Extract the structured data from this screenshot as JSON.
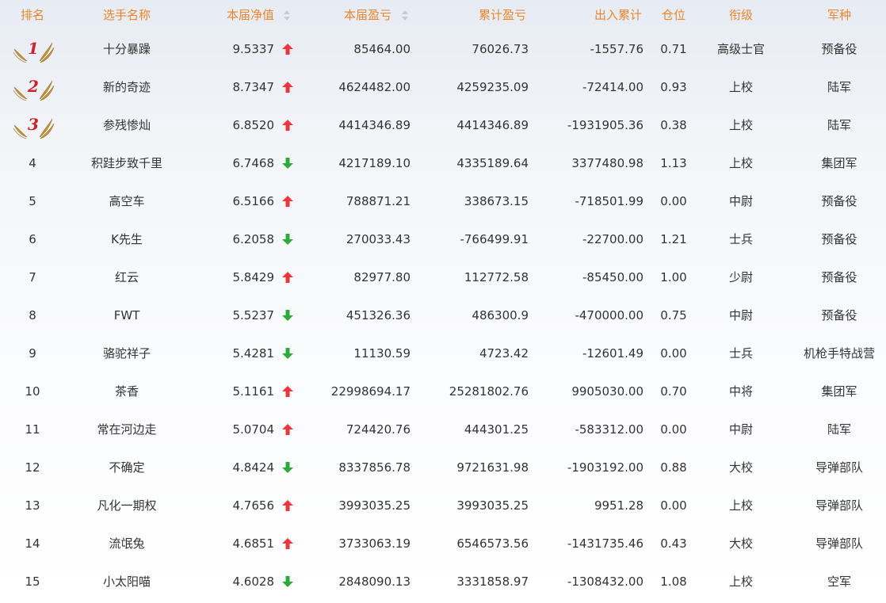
{
  "header": {
    "rank": "排名",
    "player": "选手名称",
    "nav": "本届净值",
    "profit": "本届盈亏",
    "total_profit": "累计盈亏",
    "flow": "出入累计",
    "position": "仓位",
    "title": "衔级",
    "branch": "军种"
  },
  "colors": {
    "header_text": "#e8872f",
    "up_arrow": "#e8383d",
    "down_arrow": "#2eaa3a",
    "medal_number": "#d0202a",
    "medal_wing": "#c9963a"
  },
  "rows": [
    {
      "rank": "1",
      "player": "十分暴躁",
      "nav": "9.5337",
      "trend": "up",
      "profit": "85464.00",
      "total_profit": "76026.73",
      "flow": "-1557.76",
      "position": "0.71",
      "title": "高级士官",
      "branch": "预备役"
    },
    {
      "rank": "2",
      "player": "新的奇迹",
      "nav": "8.7347",
      "trend": "up",
      "profit": "4624482.00",
      "total_profit": "4259235.09",
      "flow": "-72414.00",
      "position": "0.93",
      "title": "上校",
      "branch": "陆军"
    },
    {
      "rank": "3",
      "player": "参残惨灿",
      "nav": "6.8520",
      "trend": "up",
      "profit": "4414346.89",
      "total_profit": "4414346.89",
      "flow": "-1931905.36",
      "position": "0.38",
      "title": "上校",
      "branch": "陆军"
    },
    {
      "rank": "4",
      "player": "积跬步致千里",
      "nav": "6.7468",
      "trend": "down",
      "profit": "4217189.10",
      "total_profit": "4335189.64",
      "flow": "3377480.98",
      "position": "1.13",
      "title": "上校",
      "branch": "集团军"
    },
    {
      "rank": "5",
      "player": "高空车",
      "nav": "6.5166",
      "trend": "up",
      "profit": "788871.21",
      "total_profit": "338673.15",
      "flow": "-718501.99",
      "position": "0.00",
      "title": "中尉",
      "branch": "预备役"
    },
    {
      "rank": "6",
      "player": "K先生",
      "nav": "6.2058",
      "trend": "down",
      "profit": "270033.43",
      "total_profit": "-766499.91",
      "flow": "-22700.00",
      "position": "1.21",
      "title": "士兵",
      "branch": "预备役"
    },
    {
      "rank": "7",
      "player": "红云",
      "nav": "5.8429",
      "trend": "up",
      "profit": "82977.80",
      "total_profit": "112772.58",
      "flow": "-85450.00",
      "position": "1.00",
      "title": "少尉",
      "branch": "预备役"
    },
    {
      "rank": "8",
      "player": "FWT",
      "nav": "5.5237",
      "trend": "down",
      "profit": "451326.36",
      "total_profit": "486300.9",
      "flow": "-470000.00",
      "position": "0.75",
      "title": "中尉",
      "branch": "预备役"
    },
    {
      "rank": "9",
      "player": "骆驼祥子",
      "nav": "5.4281",
      "trend": "down",
      "profit": "11130.59",
      "total_profit": "4723.42",
      "flow": "-12601.49",
      "position": "0.00",
      "title": "士兵",
      "branch": "机枪手特战营"
    },
    {
      "rank": "10",
      "player": "茶香",
      "nav": "5.1161",
      "trend": "up",
      "profit": "22998694.17",
      "total_profit": "25281802.76",
      "flow": "9905030.00",
      "position": "0.70",
      "title": "中将",
      "branch": "集团军"
    },
    {
      "rank": "11",
      "player": "常在河边走",
      "nav": "5.0704",
      "trend": "up",
      "profit": "724420.76",
      "total_profit": "444301.25",
      "flow": "-583312.00",
      "position": "0.00",
      "title": "中尉",
      "branch": "陆军"
    },
    {
      "rank": "12",
      "player": "不确定",
      "nav": "4.8424",
      "trend": "down",
      "profit": "8337856.78",
      "total_profit": "9721631.98",
      "flow": "-1903192.00",
      "position": "0.88",
      "title": "大校",
      "branch": "导弹部队"
    },
    {
      "rank": "13",
      "player": "凡化一期权",
      "nav": "4.7656",
      "trend": "up",
      "profit": "3993035.25",
      "total_profit": "3993035.25",
      "flow": "9951.28",
      "position": "0.00",
      "title": "上校",
      "branch": "导弹部队"
    },
    {
      "rank": "14",
      "player": "流氓兔",
      "nav": "4.6851",
      "trend": "up",
      "profit": "3733063.19",
      "total_profit": "6546573.56",
      "flow": "-1431735.46",
      "position": "0.43",
      "title": "大校",
      "branch": "导弹部队"
    },
    {
      "rank": "15",
      "player": "小太阳喵",
      "nav": "4.6028",
      "trend": "down",
      "profit": "2848090.13",
      "total_profit": "3331858.97",
      "flow": "-1308432.00",
      "position": "1.08",
      "title": "上校",
      "branch": "空军"
    }
  ]
}
